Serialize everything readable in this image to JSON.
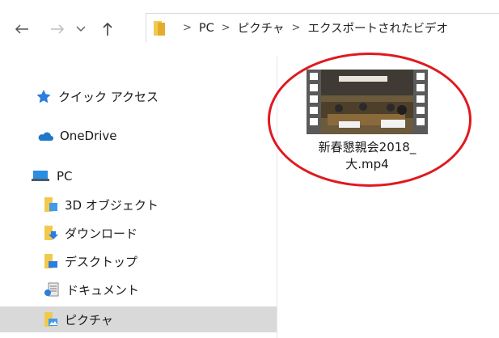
{
  "address_bar": {
    "breadcrumbs": [
      "PC",
      "ピクチャ",
      "エクスポートされたビデオ"
    ]
  },
  "sidebar": {
    "quick_access": "クイック アクセス",
    "onedrive": "OneDrive",
    "pc": "PC",
    "items": [
      "3D オブジェクト",
      "ダウンロード",
      "デスクトップ",
      "ドキュメント",
      "ピクチャ"
    ]
  },
  "file": {
    "name_line1": "新春懇親会2018_",
    "name_line2": "大.mp4"
  },
  "colors": {
    "highlight_circle": "#e0191f",
    "selected_bg": "#d9d9d9",
    "folder_yellow": "#f2c94c"
  }
}
